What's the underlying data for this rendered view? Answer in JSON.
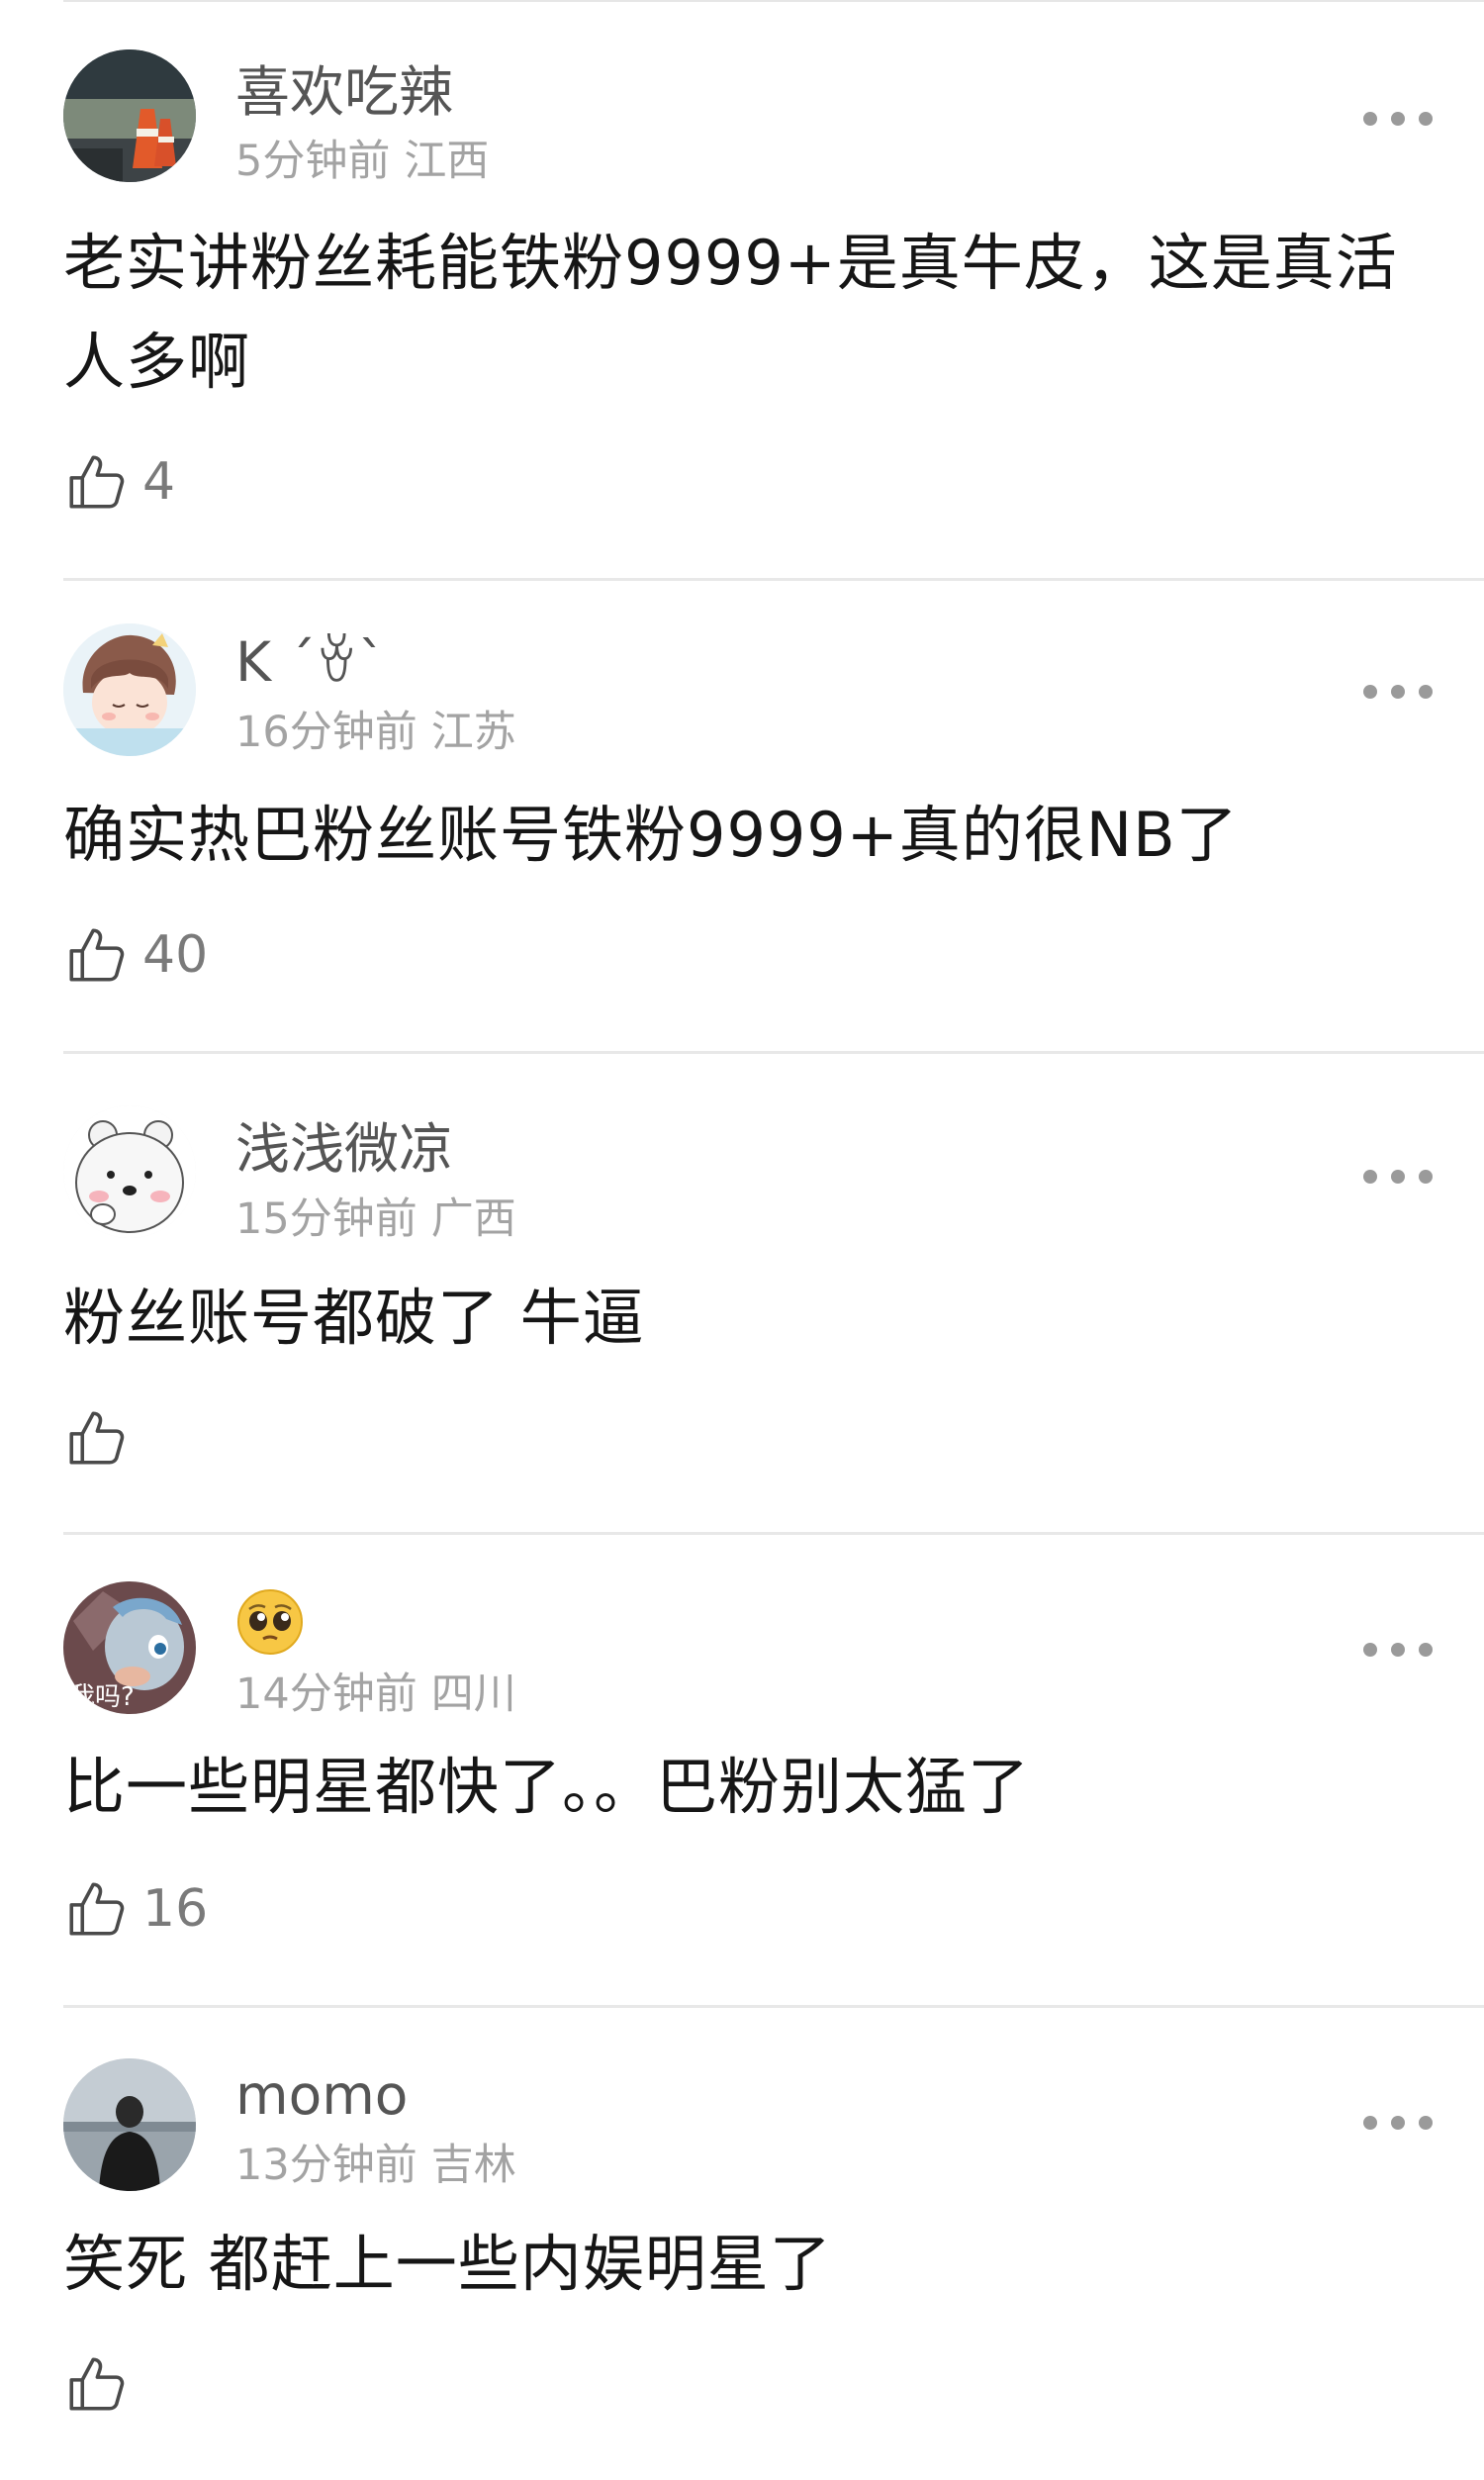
{
  "comments": [
    {
      "username": "喜欢吃辣",
      "time": "5分钟前",
      "location": "江西",
      "text": "老实讲粉丝耗能铁粉9999+是真牛皮，这是真活人多啊",
      "likes": "4"
    },
    {
      "username": "K ´ꈊ`",
      "time": "16分钟前",
      "location": "江苏",
      "text": "确实热巴粉丝账号铁粉9999+真的很NB了",
      "likes": "40"
    },
    {
      "username": "浅浅微凉",
      "time": "15分钟前",
      "location": "广西",
      "text": "粉丝账号都破了 牛逼",
      "likes": ""
    },
    {
      "username": "",
      "username_icon": "pleading-face-emoji-icon",
      "avatar_caption": "我吗?",
      "time": "14分钟前",
      "location": "四川",
      "text": "比一些明星都快了。。巴粉别太猛了",
      "likes": "16"
    },
    {
      "username": "momo",
      "time": "13分钟前",
      "location": "吉林",
      "text": "笑死 都赶上一些内娱明星了",
      "likes": ""
    }
  ],
  "icons": {
    "more": "more-dots-icon",
    "like": "thumbs-up-icon"
  },
  "colors": {
    "username": "#555555",
    "meta": "#a3a3a3",
    "body_text": "#161616",
    "like_count": "#7a7a7a",
    "divider": "#e8e8e8"
  }
}
